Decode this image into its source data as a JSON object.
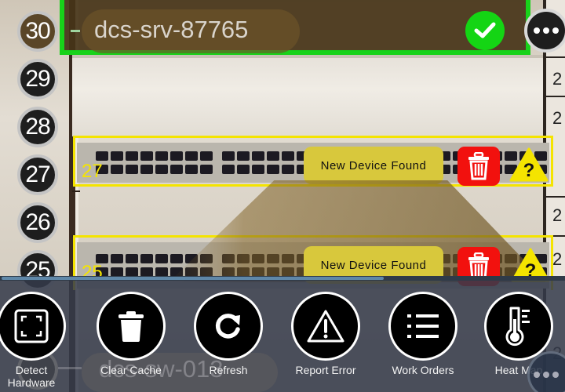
{
  "rack": {
    "units": [
      {
        "number": "30",
        "active": true
      },
      {
        "number": "29",
        "active": false
      },
      {
        "number": "28",
        "active": false
      },
      {
        "number": "27",
        "active": false
      },
      {
        "number": "26",
        "active": false
      },
      {
        "number": "25",
        "active": false
      }
    ],
    "right_labels": [
      "2",
      "2",
      "2",
      "2",
      "2"
    ],
    "ghost_unit_name": "dcs-sw-013"
  },
  "top_server": {
    "name": "dcs-srv-87765",
    "status_icon": "checkmark-icon",
    "status_color": "#14d514",
    "more_icon": "ellipsis-icon"
  },
  "devices": [
    {
      "unit_label": "27",
      "badge": "New Device Found",
      "delete_icon": "trash-icon",
      "warning_icon": "question-warning-icon"
    },
    {
      "unit_label": "25",
      "badge": "New Device Found",
      "delete_icon": "trash-icon",
      "warning_icon": "question-warning-icon"
    }
  ],
  "colors": {
    "confirmed": "#18d21a",
    "detected": "#f4e400",
    "delete": "#f2110e",
    "badge": "#d8c83c"
  },
  "progress": {
    "percent": 68
  },
  "toolbar": {
    "items": [
      {
        "label": "Detect Hardware",
        "icon": "scan-frame-icon"
      },
      {
        "label": "Clear Cache",
        "icon": "trash-icon"
      },
      {
        "label": "Refresh",
        "icon": "refresh-icon"
      },
      {
        "label": "Report Error",
        "icon": "warning-icon"
      },
      {
        "label": "Work Orders",
        "icon": "list-icon"
      },
      {
        "label": "Heat Map",
        "icon": "thermometer-icon"
      }
    ]
  }
}
